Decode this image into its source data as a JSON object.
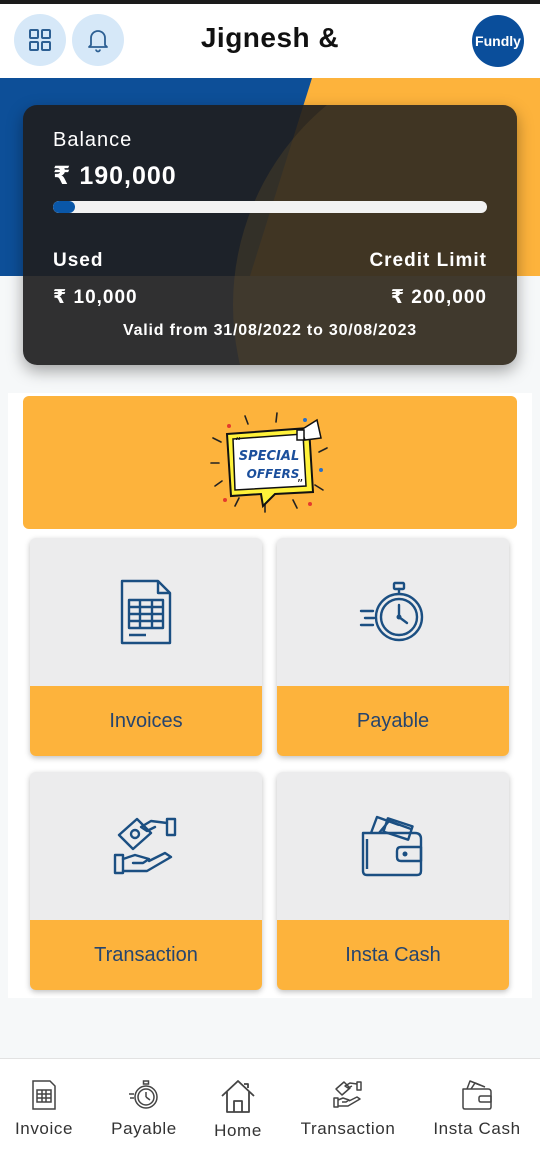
{
  "header": {
    "title": "Jignesh &",
    "logo_text": "Fundly",
    "icons": [
      "grid-icon",
      "bell-icon"
    ]
  },
  "balance_card": {
    "balance_label": "Balance",
    "balance_value": "₹ 190,000",
    "used_fraction": 0.05,
    "used_label": "Used",
    "used_value": "₹ 10,000",
    "limit_label": "Credit Limit",
    "limit_value": "₹ 200,000",
    "validity": "Valid from 31/08/2022 to 30/08/2023"
  },
  "offer": {
    "line1": "SPECIAL",
    "line2": "OFFERS"
  },
  "tiles": [
    {
      "label": "Invoices",
      "icon": "invoice-icon"
    },
    {
      "label": "Payable",
      "icon": "stopwatch-icon"
    },
    {
      "label": "Transaction",
      "icon": "handshake-money-icon"
    },
    {
      "label": "Insta Cash",
      "icon": "wallet-icon"
    }
  ],
  "bottom_nav": [
    {
      "label": "Invoice",
      "icon": "invoice-icon"
    },
    {
      "label": "Payable",
      "icon": "stopwatch-icon"
    },
    {
      "label": "Home",
      "icon": "home-icon"
    },
    {
      "label": "Transaction",
      "icon": "handshake-money-icon"
    },
    {
      "label": "Insta Cash",
      "icon": "wallet-icon"
    }
  ],
  "colors": {
    "brand_blue": "#0a4e9b",
    "accent_orange": "#fdb33c",
    "icon_blue": "#1b4f82",
    "card_dark": "#1e1e20"
  }
}
